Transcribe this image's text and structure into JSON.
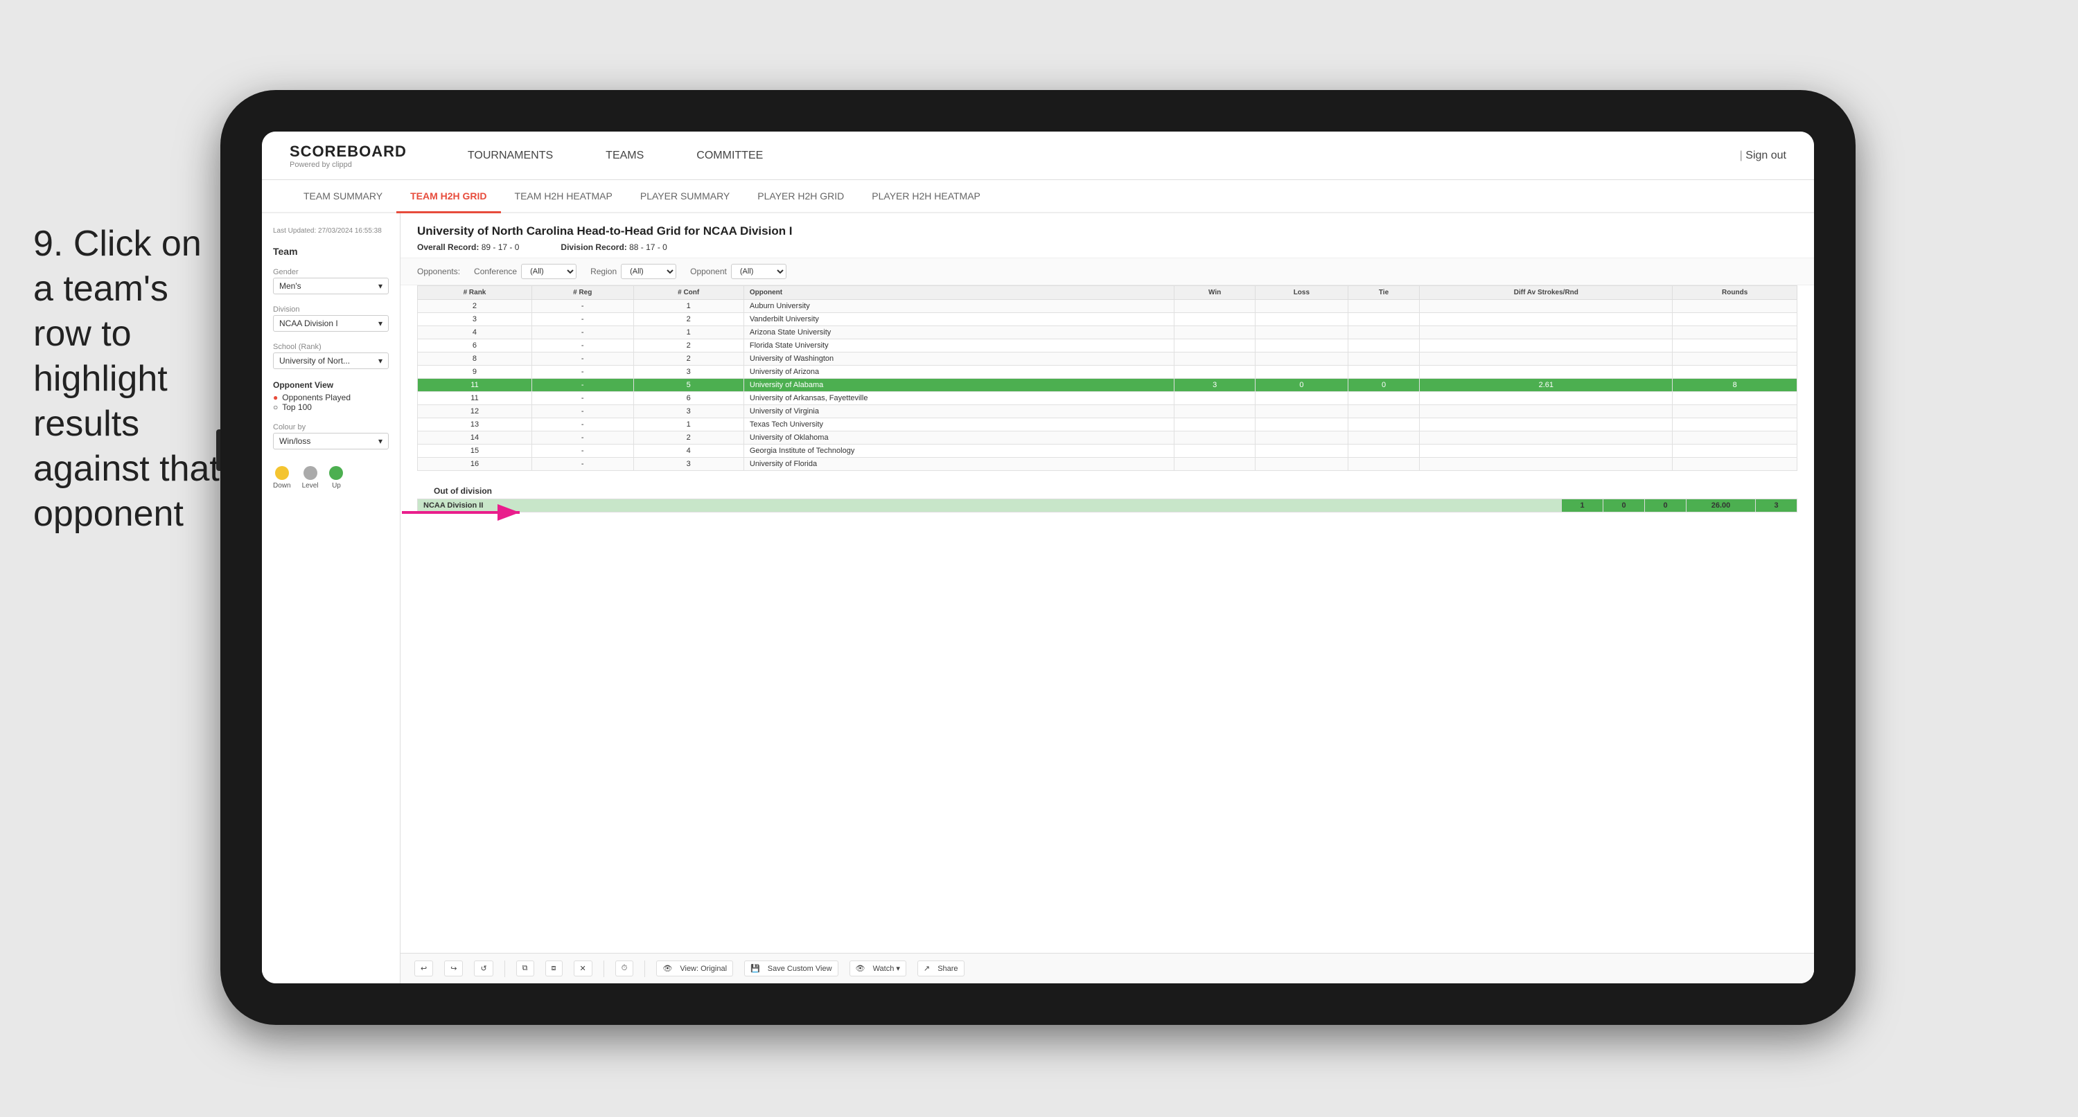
{
  "instruction": {
    "step": "9.",
    "text": "Click on a team's row to highlight results against that opponent"
  },
  "nav": {
    "logo": "SCOREBOARD",
    "logo_sub": "Powered by clippd",
    "items": [
      "TOURNAMENTS",
      "TEAMS",
      "COMMITTEE"
    ],
    "sign_out": "Sign out"
  },
  "sub_tabs": [
    {
      "label": "TEAM SUMMARY",
      "active": false
    },
    {
      "label": "TEAM H2H GRID",
      "active": true
    },
    {
      "label": "TEAM H2H HEATMAP",
      "active": false
    },
    {
      "label": "PLAYER SUMMARY",
      "active": false
    },
    {
      "label": "PLAYER H2H GRID",
      "active": false
    },
    {
      "label": "PLAYER H2H HEATMAP",
      "active": false
    }
  ],
  "sidebar": {
    "timestamp": "Last Updated: 27/03/2024 16:55:38",
    "team_label": "Team",
    "gender_label": "Gender",
    "gender_value": "Men's",
    "division_label": "Division",
    "division_value": "NCAA Division I",
    "school_label": "School (Rank)",
    "school_value": "University of Nort...",
    "opponent_view_label": "Opponent View",
    "radio1": "Opponents Played",
    "radio2": "Top 100",
    "colour_by_label": "Colour by",
    "colour_by_value": "Win/loss",
    "legend": [
      {
        "label": "Down",
        "color": "#f4c430"
      },
      {
        "label": "Level",
        "color": "#aaa"
      },
      {
        "label": "Up",
        "color": "#4caf50"
      }
    ]
  },
  "grid": {
    "title": "University of North Carolina Head-to-Head Grid for NCAA Division I",
    "overall_record_label": "Overall Record:",
    "overall_record": "89 - 17 - 0",
    "division_record_label": "Division Record:",
    "division_record": "88 - 17 - 0",
    "filters": {
      "opponents_label": "Opponents:",
      "conference_label": "Conference",
      "conference_value": "(All)",
      "region_label": "Region",
      "region_value": "(All)",
      "opponent_label": "Opponent",
      "opponent_value": "(All)"
    },
    "columns": [
      "# Rank",
      "# Reg",
      "# Conf",
      "Opponent",
      "Win",
      "Loss",
      "Tie",
      "Diff Av Strokes/Rnd",
      "Rounds"
    ],
    "rows": [
      {
        "rank": "2",
        "reg": "-",
        "conf": "1",
        "opponent": "Auburn University",
        "win": "",
        "loss": "",
        "tie": "",
        "diff": "",
        "rounds": "",
        "style": "normal"
      },
      {
        "rank": "3",
        "reg": "-",
        "conf": "2",
        "opponent": "Vanderbilt University",
        "win": "",
        "loss": "",
        "tie": "",
        "diff": "",
        "rounds": "",
        "style": "normal"
      },
      {
        "rank": "4",
        "reg": "-",
        "conf": "1",
        "opponent": "Arizona State University",
        "win": "",
        "loss": "",
        "tie": "",
        "diff": "",
        "rounds": "",
        "style": "normal"
      },
      {
        "rank": "6",
        "reg": "-",
        "conf": "2",
        "opponent": "Florida State University",
        "win": "",
        "loss": "",
        "tie": "",
        "diff": "",
        "rounds": "",
        "style": "normal"
      },
      {
        "rank": "8",
        "reg": "-",
        "conf": "2",
        "opponent": "University of Washington",
        "win": "",
        "loss": "",
        "tie": "",
        "diff": "",
        "rounds": "",
        "style": "normal"
      },
      {
        "rank": "9",
        "reg": "-",
        "conf": "3",
        "opponent": "University of Arizona",
        "win": "",
        "loss": "",
        "tie": "",
        "diff": "",
        "rounds": "",
        "style": "normal"
      },
      {
        "rank": "11",
        "reg": "-",
        "conf": "5",
        "opponent": "University of Alabama",
        "win": "3",
        "loss": "0",
        "tie": "0",
        "diff": "2.61",
        "rounds": "8",
        "style": "highlighted"
      },
      {
        "rank": "11",
        "reg": "-",
        "conf": "6",
        "opponent": "University of Arkansas, Fayetteville",
        "win": "",
        "loss": "",
        "tie": "",
        "diff": "",
        "rounds": "",
        "style": "normal"
      },
      {
        "rank": "12",
        "reg": "-",
        "conf": "3",
        "opponent": "University of Virginia",
        "win": "",
        "loss": "",
        "tie": "",
        "diff": "",
        "rounds": "",
        "style": "normal"
      },
      {
        "rank": "13",
        "reg": "-",
        "conf": "1",
        "opponent": "Texas Tech University",
        "win": "",
        "loss": "",
        "tie": "",
        "diff": "",
        "rounds": "",
        "style": "normal"
      },
      {
        "rank": "14",
        "reg": "-",
        "conf": "2",
        "opponent": "University of Oklahoma",
        "win": "",
        "loss": "",
        "tie": "",
        "diff": "",
        "rounds": "",
        "style": "normal"
      },
      {
        "rank": "15",
        "reg": "-",
        "conf": "4",
        "opponent": "Georgia Institute of Technology",
        "win": "",
        "loss": "",
        "tie": "",
        "diff": "",
        "rounds": "",
        "style": "normal"
      },
      {
        "rank": "16",
        "reg": "-",
        "conf": "3",
        "opponent": "University of Florida",
        "win": "",
        "loss": "",
        "tie": "",
        "diff": "",
        "rounds": "",
        "style": "normal"
      }
    ],
    "out_of_division_label": "Out of division",
    "out_of_division_rows": [
      {
        "label": "NCAA Division II",
        "win": "1",
        "loss": "0",
        "tie": "0",
        "diff": "26.00",
        "rounds": "3"
      }
    ]
  },
  "toolbar": {
    "view_btn": "View: Original",
    "save_btn": "Save Custom View",
    "watch_btn": "Watch ▾",
    "share_btn": "Share"
  }
}
